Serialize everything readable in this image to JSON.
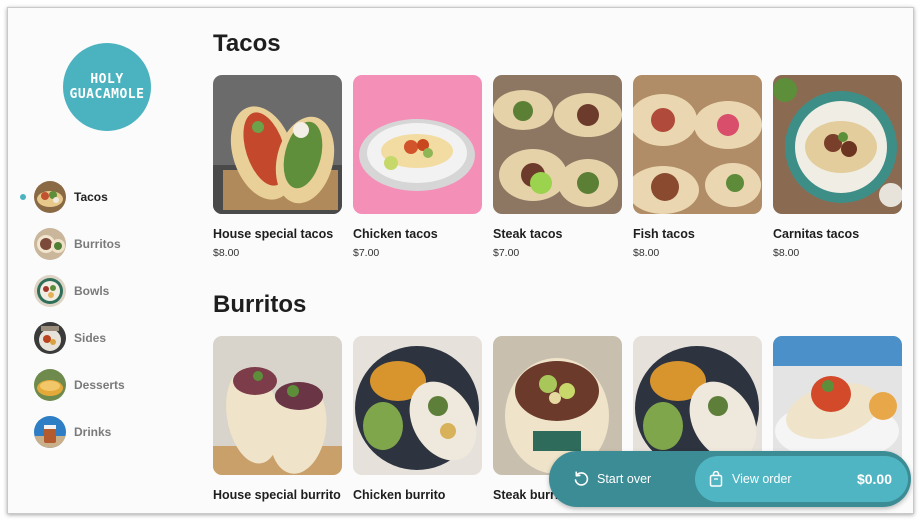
{
  "brand": {
    "line1": "HOLY",
    "line2": "GUACAMOLE",
    "color": "#4bb3c0"
  },
  "sidebar": {
    "items": [
      {
        "label": "Tacos",
        "active": true
      },
      {
        "label": "Burritos",
        "active": false
      },
      {
        "label": "Bowls",
        "active": false
      },
      {
        "label": "Sides",
        "active": false
      },
      {
        "label": "Desserts",
        "active": false
      },
      {
        "label": "Drinks",
        "active": false
      }
    ]
  },
  "sections": {
    "tacos": {
      "title": "Tacos",
      "items": [
        {
          "name": "House special tacos",
          "price": "$8.00"
        },
        {
          "name": "Chicken tacos",
          "price": "$7.00"
        },
        {
          "name": "Steak tacos",
          "price": "$7.00"
        },
        {
          "name": "Fish tacos",
          "price": "$8.00"
        },
        {
          "name": "Carnitas tacos",
          "price": "$8.00"
        }
      ]
    },
    "burritos": {
      "title": "Burritos",
      "items": [
        {
          "name": "House special burrito"
        },
        {
          "name": "Chicken burrito"
        },
        {
          "name": "Steak burrito"
        }
      ]
    }
  },
  "actions": {
    "start_over": "Start over",
    "view_order": "View order",
    "order_total": "$0.00"
  },
  "colors": {
    "accent": "#4bb3c0",
    "bar": "#3c8c95"
  }
}
